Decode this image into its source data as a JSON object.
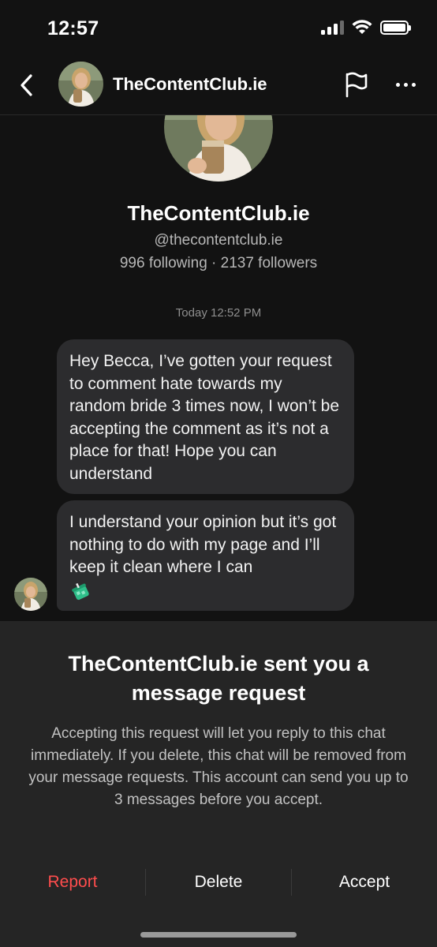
{
  "status_bar": {
    "time": "12:57"
  },
  "header": {
    "name": "TheContentClub.ie",
    "back_icon": "chevron-left-icon",
    "flag_icon": "flag-icon",
    "more_icon": "more-horizontal-icon"
  },
  "profile": {
    "name": "TheContentClub.ie",
    "handle": "@thecontentclub.ie",
    "stats": "996 following · 2137 followers"
  },
  "conversation": {
    "timestamp": "Today 12:52 PM",
    "messages": [
      {
        "text": "Hey Becca, I’ve gotten your request to comment  hate towards my random bride 3 times now, I won’t be accepting the comment as it’s not a place for that! Hope you can understand"
      },
      {
        "text": "I understand your opinion but it’s got nothing to do with my page and I’ll keep it clean where I can",
        "emoji_icon": "iced-coffee-cup-icon"
      }
    ]
  },
  "request_sheet": {
    "title": "TheContentClub.ie sent you a message request",
    "body": "Accepting this request will let you reply to this chat immediately. If you delete, this chat will be removed from your message requests. This account can send you up to 3 messages before you accept.",
    "actions": {
      "report": "Report",
      "delete": "Delete",
      "accept": "Accept"
    }
  },
  "colors": {
    "background": "#121212",
    "bubble": "#2c2c2e",
    "sheet": "#252525",
    "report": "#ff4d4d"
  }
}
